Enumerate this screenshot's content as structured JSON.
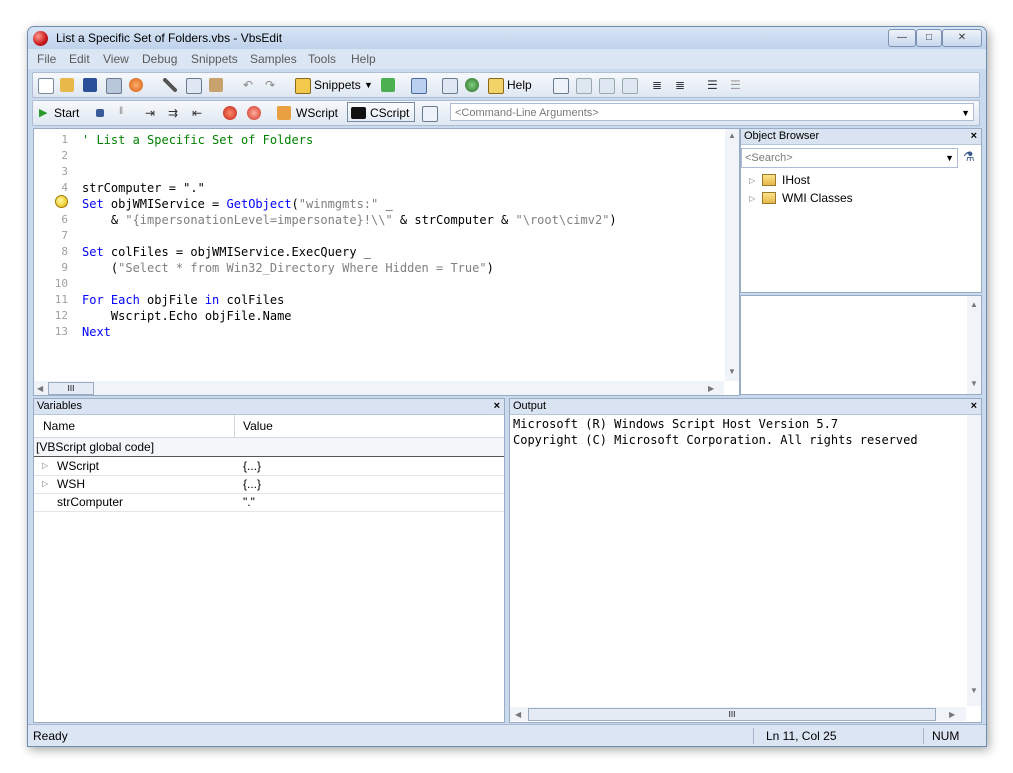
{
  "window": {
    "title": "List a Specific Set of Folders.vbs - VbsEdit"
  },
  "window_buttons": {
    "minimize": "—",
    "maximize": "□",
    "close": "✕"
  },
  "menu": [
    "File",
    "Edit",
    "View",
    "Debug",
    "Snippets",
    "Samples",
    "Tools",
    "Help"
  ],
  "toolbar1": {
    "snippets_label": "Snippets",
    "help_label": "Help"
  },
  "toolbar2": {
    "start_label": "Start",
    "wscript_label": "WScript",
    "cscript_label": "CScript",
    "cmd_placeholder": "<Command-Line Arguments>"
  },
  "editor": {
    "lines": [
      {
        "n": "1",
        "tokens": [
          {
            "t": "' List a Specific Set of Folders",
            "c": "cmt"
          }
        ]
      },
      {
        "n": "2",
        "tokens": []
      },
      {
        "n": "3",
        "tokens": []
      },
      {
        "n": "4",
        "tokens": [
          {
            "t": "strComputer = \".\"",
            "c": "plain"
          }
        ]
      },
      {
        "n": "5",
        "tokens": [
          {
            "t": "Set",
            "c": "kw"
          },
          {
            "t": " objWMIService = ",
            "c": "plain"
          },
          {
            "t": "GetObject",
            "c": "kw"
          },
          {
            "t": "(",
            "c": "plain"
          },
          {
            "t": "\"winmgmts:\"",
            "c": "str"
          },
          {
            "t": " _",
            "c": "plain"
          }
        ]
      },
      {
        "n": "6",
        "tokens": [
          {
            "t": "    & ",
            "c": "plain"
          },
          {
            "t": "\"{impersonationLevel=impersonate}!\\\\\"",
            "c": "str"
          },
          {
            "t": " & strComputer & ",
            "c": "plain"
          },
          {
            "t": "\"\\root\\cimv2\"",
            "c": "str"
          },
          {
            "t": ")",
            "c": "plain"
          }
        ]
      },
      {
        "n": "7",
        "tokens": []
      },
      {
        "n": "8",
        "tokens": [
          {
            "t": "Set",
            "c": "kw"
          },
          {
            "t": " colFiles = objWMIService.ExecQuery _",
            "c": "plain"
          }
        ]
      },
      {
        "n": "9",
        "tokens": [
          {
            "t": "    (",
            "c": "plain"
          },
          {
            "t": "\"Select * from Win32_Directory Where Hidden = True\"",
            "c": "str"
          },
          {
            "t": ")",
            "c": "plain"
          }
        ]
      },
      {
        "n": "10",
        "tokens": []
      },
      {
        "n": "11",
        "tokens": [
          {
            "t": "For Each",
            "c": "kw"
          },
          {
            "t": " objFile ",
            "c": "plain"
          },
          {
            "t": "in",
            "c": "kw"
          },
          {
            "t": " colFiles",
            "c": "plain"
          }
        ]
      },
      {
        "n": "12",
        "tokens": [
          {
            "t": "    Wscript.Echo objFile.Name",
            "c": "plain"
          }
        ]
      },
      {
        "n": "13",
        "tokens": [
          {
            "t": "Next",
            "c": "kw"
          }
        ]
      }
    ],
    "hscroll_grip": "III"
  },
  "object_browser": {
    "title": "Object Browser",
    "search_placeholder": "<Search>",
    "items": [
      "IHost",
      "WMI Classes"
    ],
    "close": "×"
  },
  "variables": {
    "title": "Variables",
    "close": "×",
    "col_name": "Name",
    "col_value": "Value",
    "group": "[VBScript global code]",
    "rows": [
      {
        "name": "WScript",
        "value": "{...}",
        "expandable": true
      },
      {
        "name": "WSH",
        "value": "{...}",
        "expandable": true
      },
      {
        "name": "strComputer",
        "value": "\".\"",
        "expandable": false
      }
    ]
  },
  "output": {
    "title": "Output",
    "close": "×",
    "lines": [
      "Microsoft (R) Windows Script Host Version 5.7",
      "Copyright (C) Microsoft Corporation. All rights reserved"
    ],
    "hscroll_grip": "III"
  },
  "status": {
    "left": "Ready",
    "position": "Ln 11, Col 25",
    "num": "NUM"
  },
  "colors": {
    "keyword": "#0000ff",
    "string": "#808080",
    "comment": "#008000",
    "frame": "#c9d9ee"
  }
}
